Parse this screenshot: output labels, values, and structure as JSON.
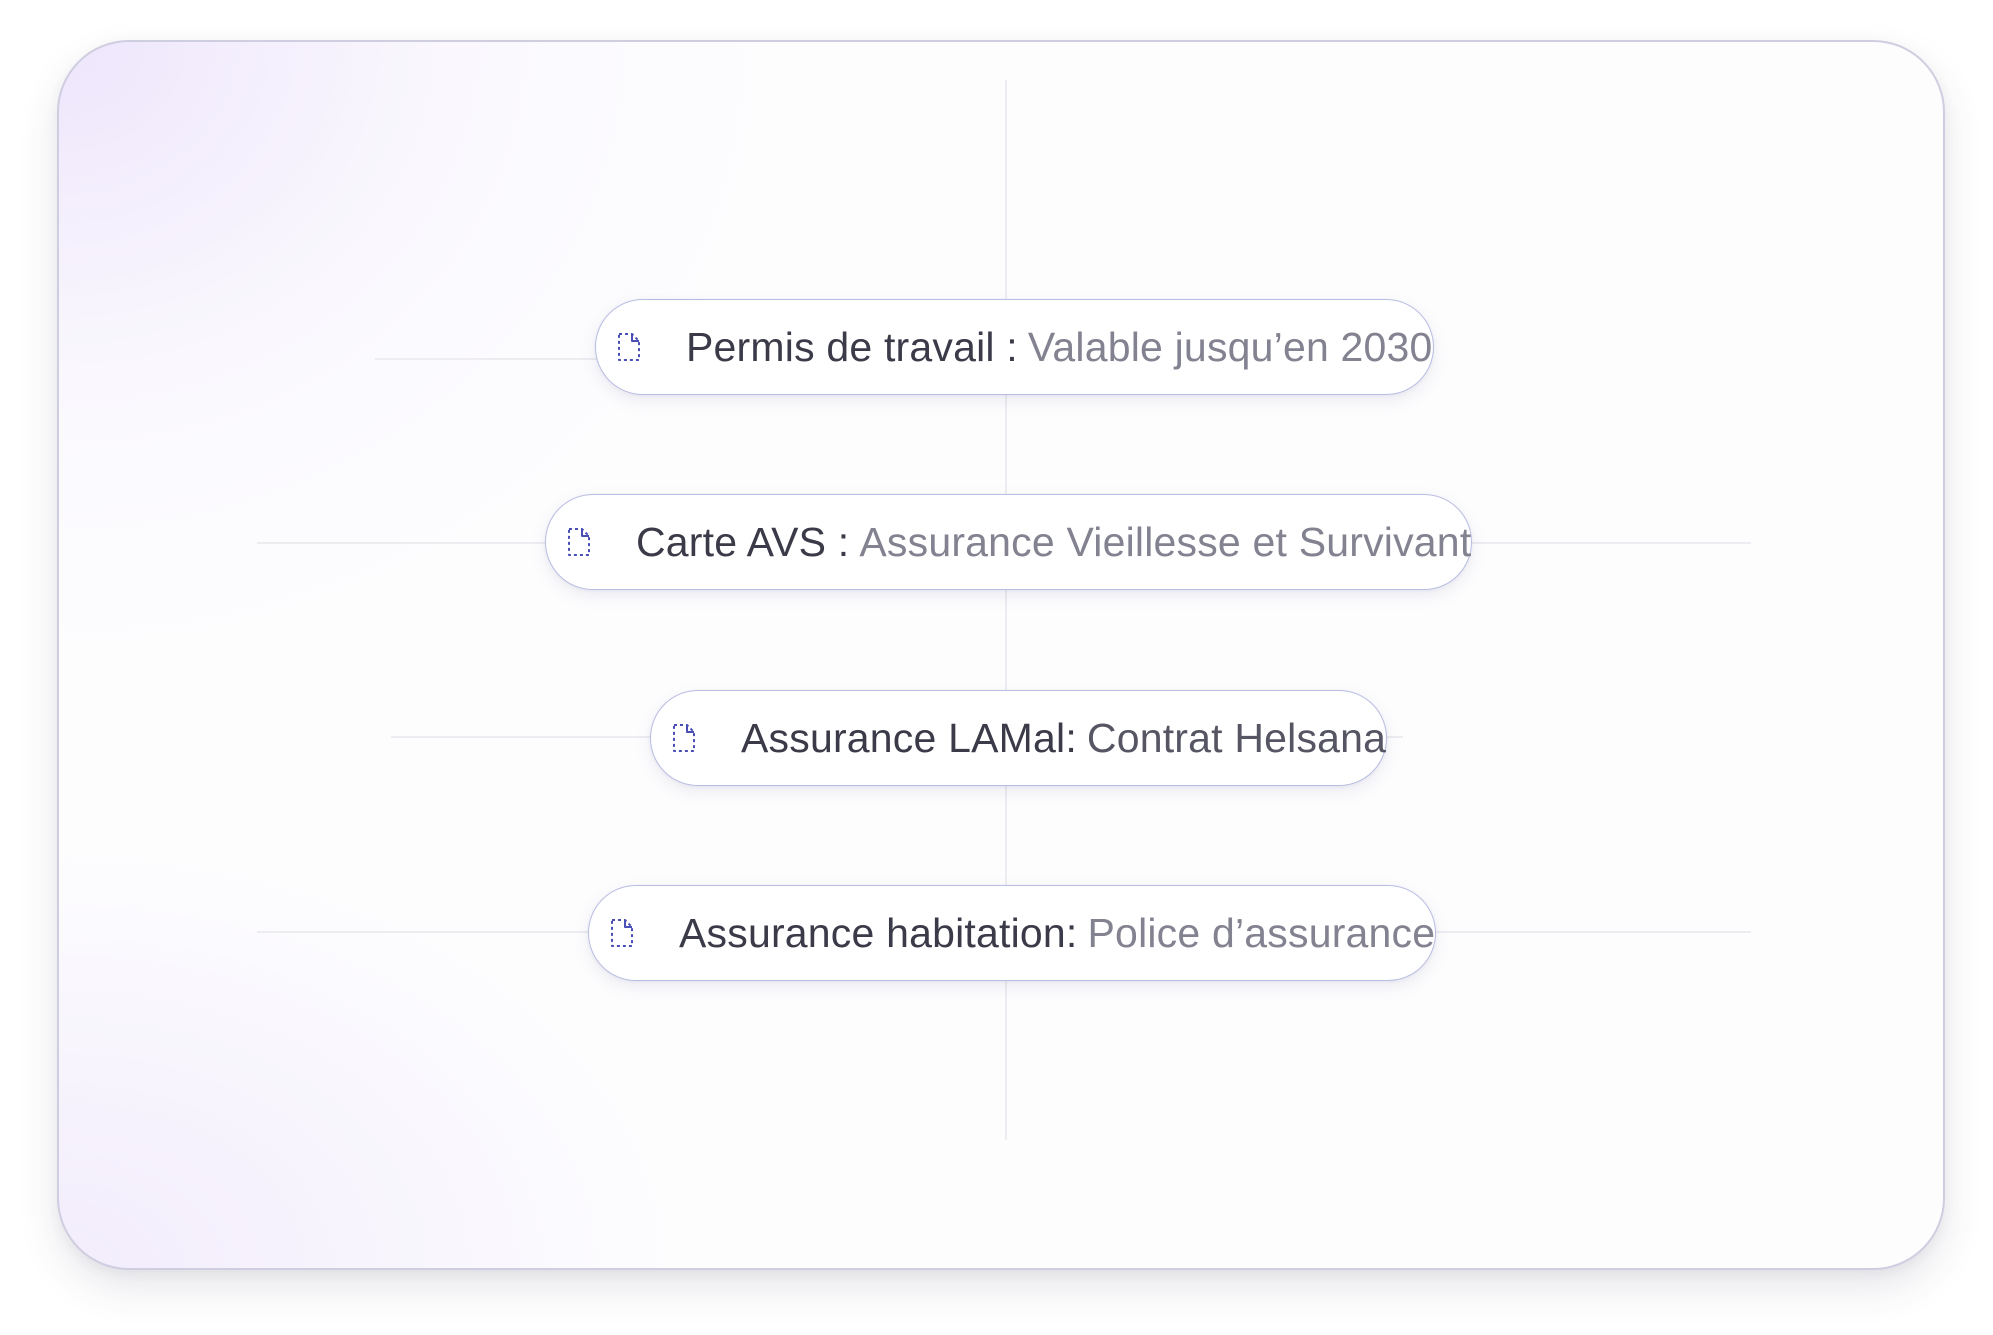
{
  "colors": {
    "card_border": "#cfcde0",
    "pill_border": "#b9bde3",
    "icon": "#4a4fb8",
    "label_text": "#3a3a48",
    "value_text": "#828290",
    "connector_line": "#ececf1"
  },
  "documents": [
    {
      "icon": "file-icon",
      "label": "Permis de travail :",
      "value": "Valable jusqu’en 2030"
    },
    {
      "icon": "file-icon",
      "label": "Carte AVS :",
      "value": "Assurance Vieillesse et Survivant"
    },
    {
      "icon": "file-icon",
      "label": "Assurance LAMal:",
      "value": "Contrat Helsana"
    },
    {
      "icon": "file-icon",
      "label": "Assurance habitation:",
      "value": "Police d’assurance"
    }
  ]
}
